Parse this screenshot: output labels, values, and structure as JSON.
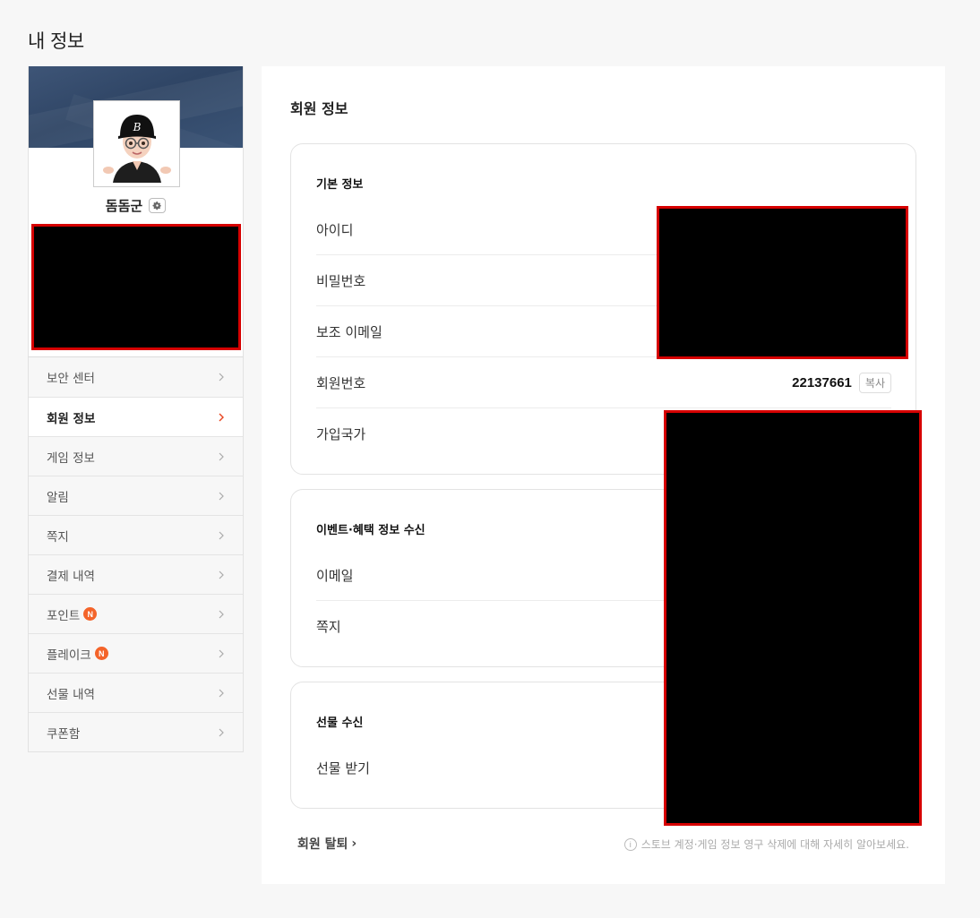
{
  "page": {
    "title": "내 정보"
  },
  "profile": {
    "nickname": "돔돔군",
    "avatar_icon": "avatar-character-icon",
    "settings_icon": "gear-icon"
  },
  "sidebar": {
    "items": [
      {
        "label": "보안 센터",
        "active": false,
        "badge": ""
      },
      {
        "label": "회원 정보",
        "active": true,
        "badge": ""
      },
      {
        "label": "게임 정보",
        "active": false,
        "badge": ""
      },
      {
        "label": "알림",
        "active": false,
        "badge": ""
      },
      {
        "label": "쪽지",
        "active": false,
        "badge": ""
      },
      {
        "label": "결제 내역",
        "active": false,
        "badge": ""
      },
      {
        "label": "포인트",
        "active": false,
        "badge": "N"
      },
      {
        "label": "플레이크",
        "active": false,
        "badge": "N"
      },
      {
        "label": "선물 내역",
        "active": false,
        "badge": ""
      },
      {
        "label": "쿠폰함",
        "active": false,
        "badge": ""
      }
    ],
    "active_chevron_color": "#e8431e"
  },
  "main": {
    "title": "회원 정보",
    "basic": {
      "title": "기본 정보",
      "rows": {
        "id": "아이디",
        "password": "비밀번호",
        "backup_email": "보조 이메일",
        "member_no_label": "회원번호",
        "member_no_value": "22137661",
        "copy_label": "복사",
        "country": "가입국가"
      }
    },
    "event": {
      "title": "이벤트·혜택 정보 수신",
      "rows": {
        "email": "이메일",
        "message": "쪽지"
      }
    },
    "gift": {
      "title": "선물 수신",
      "rows": {
        "receive": "선물 받기"
      }
    },
    "footer": {
      "withdraw": "회원 탈퇴",
      "withdraw_arrow": "›",
      "notice": "스토브 계정·게임 정보 영구 삭제에 대해 자세히 알아보세요.",
      "info_glyph": "i"
    }
  }
}
